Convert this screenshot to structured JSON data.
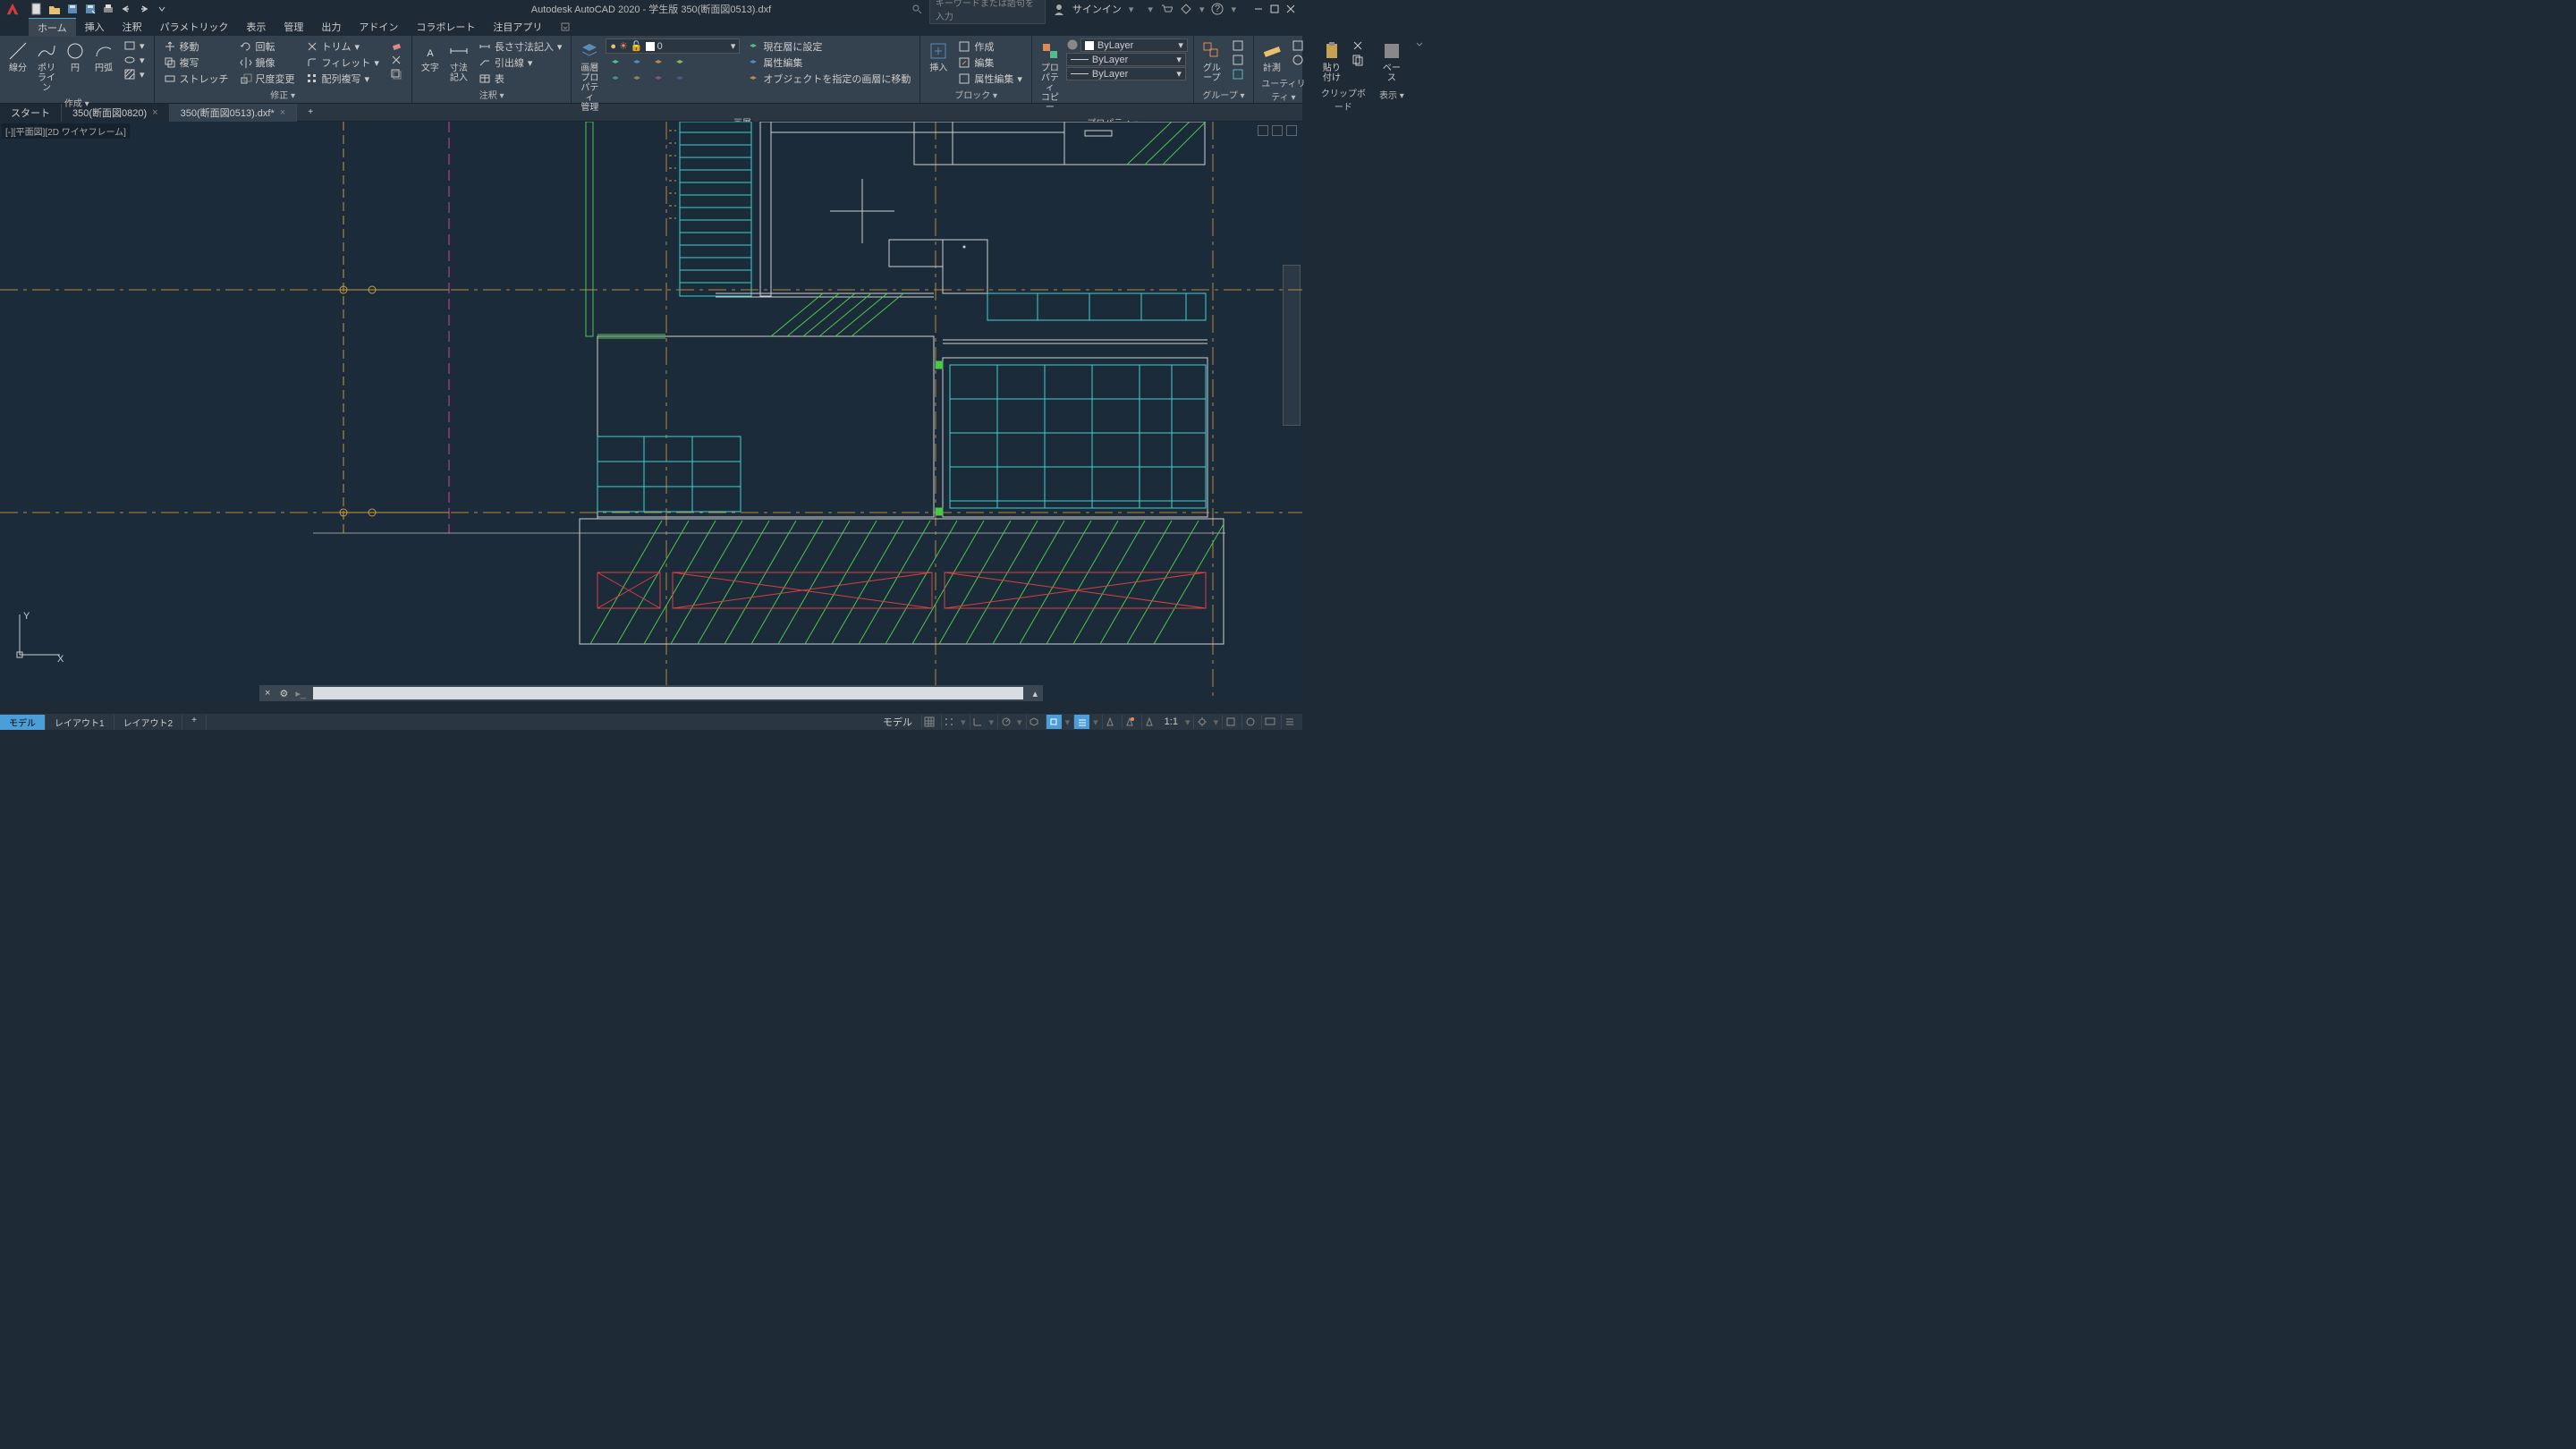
{
  "titlebar": {
    "app_title": "Autodesk AutoCAD 2020 - 学生版    350(断面図0513).dxf",
    "search_placeholder": "キーワードまたは語句を入力",
    "signin": "サインイン"
  },
  "menubar": {
    "items": [
      "ホーム",
      "挿入",
      "注釈",
      "パラメトリック",
      "表示",
      "管理",
      "出力",
      "アドイン",
      "コラボレート",
      "注目アプリ"
    ],
    "active": 0
  },
  "ribbon": {
    "draw": {
      "title": "作成 ▾",
      "line": "線分",
      "polyline": "ポリライン",
      "circle": "円",
      "arc": "円弧"
    },
    "modify": {
      "title": "修正 ▾",
      "move": "移動",
      "copy": "複写",
      "stretch": "ストレッチ",
      "rotate": "回転",
      "mirror": "鏡像",
      "scale": "尺度変更",
      "trim": "トリム",
      "fillet": "フィレット",
      "array": "配列複写"
    },
    "annotation": {
      "title": "注釈 ▾",
      "text": "文字",
      "dim": "寸法記入",
      "dimlen": "長さ寸法記入",
      "leader": "引出線",
      "table": "表"
    },
    "layers": {
      "title": "画層 ▾",
      "layerprops": "画層プロパティ\n管理",
      "current_layer": "0",
      "setcurrent": "現在層に設定",
      "layeredit": "属性編集",
      "moveto": "オブジェクトを指定の画層に移動"
    },
    "block": {
      "title": "ブロック ▾",
      "insert": "挿入",
      "create": "作成",
      "edit": "編集",
      "editattr": "属性編集"
    },
    "properties": {
      "title": "プロパティ ▾",
      "propcopy": "プロパティ\nコピー",
      "bylayer": "ByLayer"
    },
    "groups": {
      "title": "グループ ▾",
      "group": "グループ"
    },
    "utilities": {
      "title": "ユーティリティ ▾",
      "measure": "計測"
    },
    "clipboard": {
      "title": "クリップボード",
      "paste": "貼り付け"
    },
    "view": {
      "title": "表示 ▾",
      "base": "ベース"
    }
  },
  "filetabs": {
    "tabs": [
      {
        "label": "スタート",
        "closable": false
      },
      {
        "label": "350(断面図0820)",
        "closable": true
      },
      {
        "label": "350(断面図0513).dxf*",
        "closable": true
      }
    ],
    "active": 2
  },
  "viewport": {
    "label": "[-][平面図][2D ワイヤフレーム]"
  },
  "layouttabs": {
    "tabs": [
      "モデル",
      "レイアウト1",
      "レイアウト2"
    ],
    "active": 0
  },
  "statusbar": {
    "model": "モデル",
    "scale": "1:1"
  }
}
